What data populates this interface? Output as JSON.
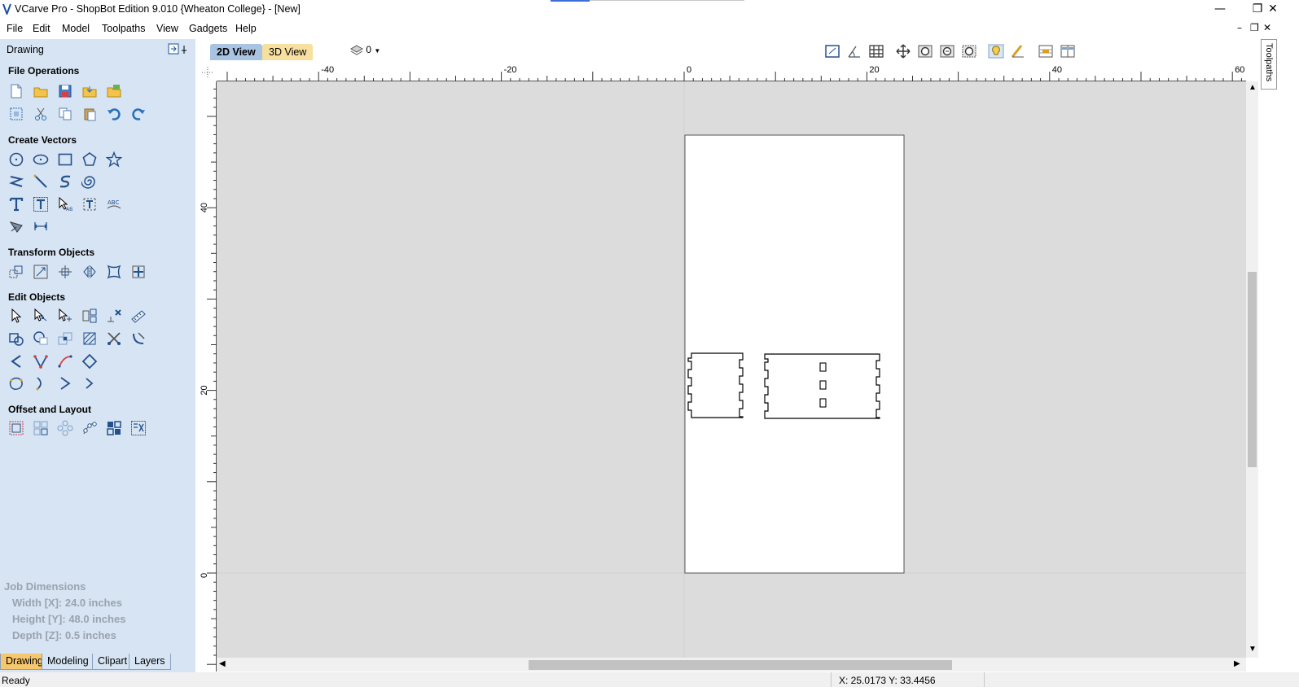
{
  "window": {
    "title": "VCarve Pro - ShopBot Edition 9.010 {Wheaton College} - [New]",
    "minimize": "—",
    "restore": "❐",
    "close": "✕"
  },
  "menu": {
    "items": [
      "File",
      "Edit",
      "Model",
      "Toolpaths",
      "View",
      "Gadgets",
      "Help"
    ],
    "mdi_minimize": "–",
    "mdi_restore": "❐",
    "mdi_close": "✕"
  },
  "left_panel": {
    "title": "Drawing",
    "sections": {
      "file_operations": "File Operations",
      "create_vectors": "Create Vectors",
      "transform_objects": "Transform Objects",
      "edit_objects": "Edit Objects",
      "offset_layout": "Offset and Layout"
    },
    "job_dimensions": {
      "heading": "Job Dimensions",
      "width": "Width  [X]: 24.0 inches",
      "height": "Height [Y]: 48.0 inches",
      "depth": "Depth  [Z]: 0.5 inches"
    },
    "tabs": [
      "Drawing",
      "Modeling",
      "Clipart",
      "Layers"
    ],
    "active_tab": "Drawing"
  },
  "view_tabs": {
    "tab_2d": "2D View",
    "tab_3d": "3D View",
    "layer_value": "0"
  },
  "right_strip": {
    "label": "Toolpaths"
  },
  "rulers": {
    "top_labels": [
      "-40",
      "-20",
      "0",
      "20",
      "40",
      "60"
    ],
    "left_labels": [
      "40",
      "20",
      "0"
    ]
  },
  "status": {
    "text": "Ready",
    "coords": "X: 25.0173 Y: 33.4456"
  },
  "colors": {
    "panel_bg": "#d6e4f3",
    "canvas_bg": "#dcdcdc",
    "active_tab": "#f5c76e",
    "tool_blue": "#2a6fb8"
  }
}
